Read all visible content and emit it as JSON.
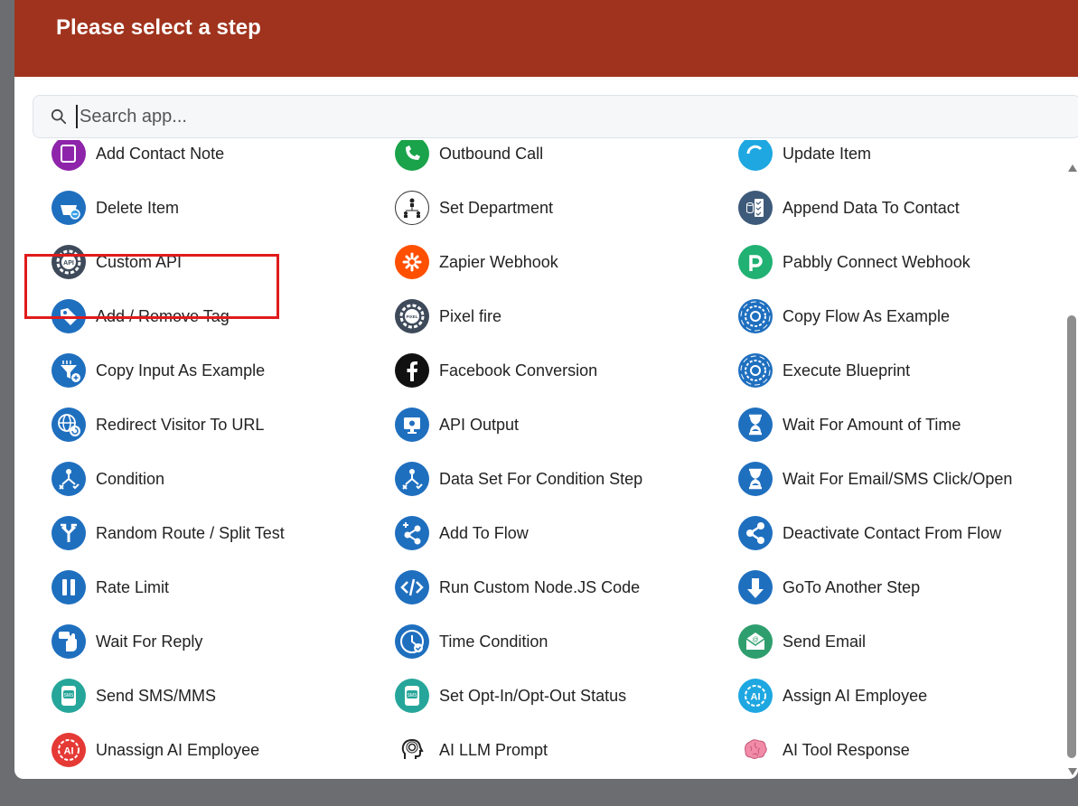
{
  "header": {
    "title": "Please select a step"
  },
  "search": {
    "placeholder": "Search app..."
  },
  "rows": [
    [
      "Add Contact Note",
      "Outbound Call",
      "Update Item"
    ],
    [
      "Delete Item",
      "Set Department",
      "Append Data To Contact"
    ],
    [
      "Custom API",
      "Zapier Webhook",
      "Pabbly Connect Webhook"
    ],
    [
      "Add / Remove Tag",
      "Pixel fire",
      "Copy Flow As Example"
    ],
    [
      "Copy Input As Example",
      "Facebook Conversion",
      "Execute Blueprint"
    ],
    [
      "Redirect Visitor To URL",
      "API Output",
      "Wait For Amount of Time"
    ],
    [
      "Condition",
      "Data Set For Condition Step",
      "Wait For Email/SMS Click/Open"
    ],
    [
      "Random Route / Split Test",
      "Add To Flow",
      "Deactivate Contact From Flow"
    ],
    [
      "Rate Limit",
      "Run Custom Node.JS Code",
      "GoTo Another Step"
    ],
    [
      "Wait For Reply",
      "Time Condition",
      "Send Email"
    ],
    [
      "Send SMS/MMS",
      "Set Opt-In/Opt-Out Status",
      "Assign AI Employee"
    ],
    [
      "Unassign AI Employee",
      "AI LLM Prompt",
      "AI Tool Response"
    ]
  ],
  "icons": [
    [
      "note-icon",
      "phone-icon",
      "update-icon"
    ],
    [
      "basket-delete-icon",
      "department-icon",
      "append-data-icon"
    ],
    [
      "api-gear-icon",
      "zapier-icon",
      "pabbly-icon"
    ],
    [
      "tag-icon",
      "pixel-gear-icon",
      "gear-copy-icon"
    ],
    [
      "funnel-icon",
      "facebook-icon",
      "gear-execute-icon"
    ],
    [
      "globe-redirect-icon",
      "monitor-output-icon",
      "hourglass-icon"
    ],
    [
      "condition-icon",
      "condition-icon",
      "hourglass-icon"
    ],
    [
      "split-route-icon",
      "share-add-icon",
      "share-icon"
    ],
    [
      "pause-icon",
      "code-icon",
      "goto-arrow-icon"
    ],
    [
      "hand-reply-icon",
      "clock-icon",
      "email-icon"
    ],
    [
      "sms-icon",
      "sms-icon",
      "ai-icon"
    ],
    [
      "ai-icon",
      "head-icon",
      "brain-icon"
    ]
  ],
  "highlighted_item": "Redirect Visitor To URL",
  "colors": {
    "header_bg": "#a0331d",
    "highlight_border": "#e01b1b",
    "icon_blue": "#1f6fbf",
    "zapier_orange": "#ff4f00",
    "pabbly_green": "#20b173",
    "note_purple": "#8e24aa",
    "phone_green": "#1aa34a",
    "ai_red": "#e53935"
  }
}
